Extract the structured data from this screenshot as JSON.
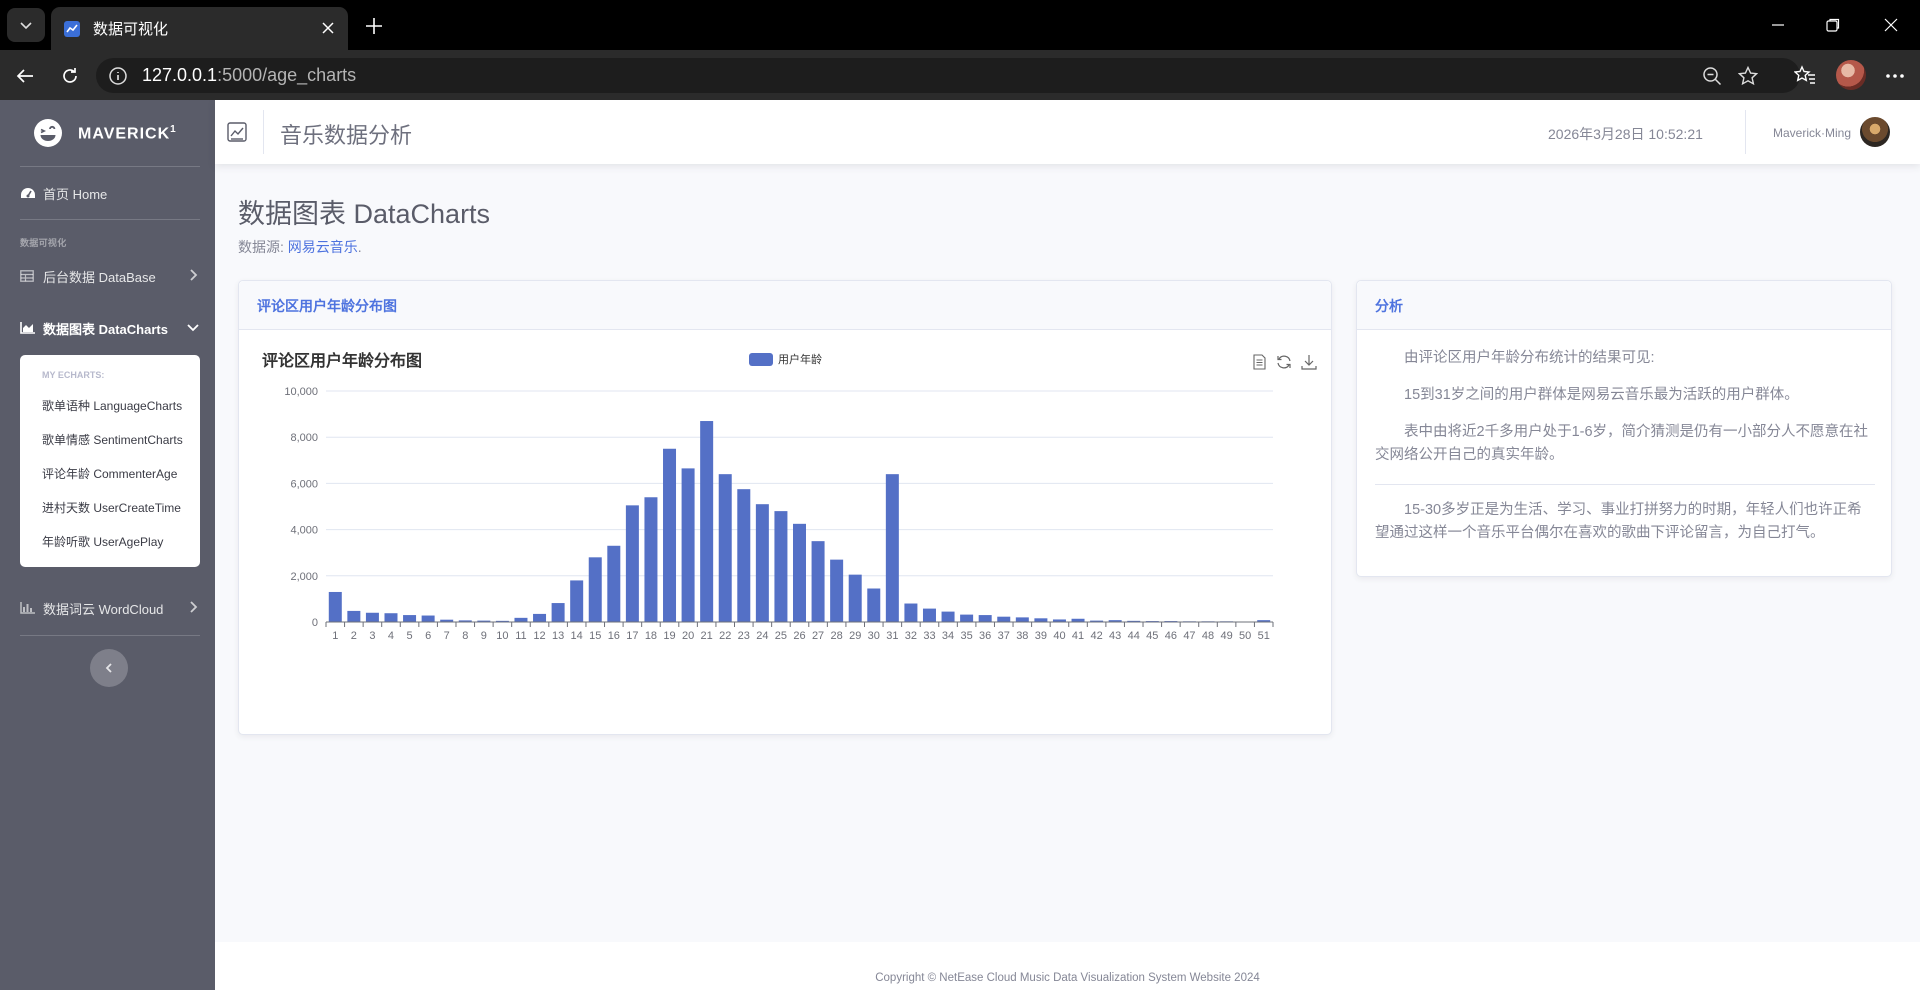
{
  "browser": {
    "tab_title": "数据可视化",
    "url_host": "127.0.0.1",
    "url_path": ":5000/age_charts"
  },
  "sidebar": {
    "brand": "MAVERICK",
    "brand_sup": "1",
    "home_label": "首页 Home",
    "section_heading": "数据可视化",
    "items": [
      {
        "label": "后台数据 DataBase"
      },
      {
        "label": "数据图表 DataCharts"
      },
      {
        "label": "数据词云 WordCloud"
      }
    ],
    "submenu": {
      "heading": "MY ECHARTS:",
      "items": [
        {
          "label": "歌单语种 LanguageCharts"
        },
        {
          "label": "歌单情感 SentimentCharts"
        },
        {
          "label": "评论年龄 CommenterAge"
        },
        {
          "label": "进村天数 UserCreateTime"
        },
        {
          "label": "年龄听歌 UserAgePlay"
        }
      ]
    }
  },
  "topbar": {
    "title": "音乐数据分析",
    "datetime": "2026年3月28日 10:52:21",
    "username": "Maverick·Ming"
  },
  "page": {
    "heading": "数据图表 DataCharts",
    "source_prefix": "数据源: ",
    "source_link": "网易云音乐",
    "source_suffix": "."
  },
  "chart_card": {
    "header": "评论区用户年龄分布图"
  },
  "analysis_card": {
    "header": "分析",
    "paragraphs": [
      "由评论区用户年龄分布统计的结果可见:",
      "15到31岁之间的用户群体是网易云音乐最为活跃的用户群体。",
      "表中由将近2千多用户处于1-6岁，简介猜测是仍有一小部分人不愿意在社交网络公开自己的真实年龄。",
      "15-30多岁正是为生活、学习、事业打拼努力的时期，年轻人们也许正希望通过这样一个音乐平台偶尔在喜欢的歌曲下评论留言，为自己打气。"
    ]
  },
  "footer": {
    "copyright": "Copyright © NetEase Cloud Music Data Visualization System Website 2024"
  },
  "colors": {
    "primary": "#4e73df",
    "bar": "#5470c6",
    "sidebar": "#5a5c69"
  },
  "chart_data": {
    "type": "bar",
    "title": "评论区用户年龄分布图",
    "legend": [
      "用户年龄"
    ],
    "legend_position": "top-center",
    "xlabel": "",
    "ylabel": "",
    "ylim": [
      0,
      10000
    ],
    "yticks": [
      0,
      2000,
      4000,
      6000,
      8000,
      10000
    ],
    "ytick_labels": [
      "0",
      "2,000",
      "4,000",
      "6,000",
      "8,000",
      "10,000"
    ],
    "grid": true,
    "categories": [
      "1",
      "2",
      "3",
      "4",
      "5",
      "6",
      "7",
      "8",
      "9",
      "10",
      "11",
      "12",
      "13",
      "14",
      "15",
      "16",
      "17",
      "18",
      "19",
      "20",
      "21",
      "22",
      "23",
      "24",
      "25",
      "26",
      "27",
      "28",
      "29",
      "30",
      "31",
      "32",
      "33",
      "34",
      "35",
      "36",
      "37",
      "38",
      "39",
      "40",
      "41",
      "42",
      "43",
      "44",
      "45",
      "46",
      "47",
      "48",
      "49",
      "50",
      "51"
    ],
    "series": [
      {
        "name": "用户年龄",
        "values": [
          1300,
          480,
          400,
          380,
          300,
          280,
          100,
          70,
          60,
          50,
          180,
          350,
          820,
          1800,
          2800,
          3300,
          5050,
          5400,
          7500,
          6650,
          8700,
          6400,
          5750,
          5100,
          4800,
          4250,
          3500,
          2700,
          2050,
          1450,
          6400,
          800,
          580,
          450,
          320,
          300,
          230,
          200,
          160,
          110,
          140,
          60,
          80,
          50,
          40,
          40,
          30,
          30,
          30,
          20,
          80
        ]
      }
    ]
  }
}
